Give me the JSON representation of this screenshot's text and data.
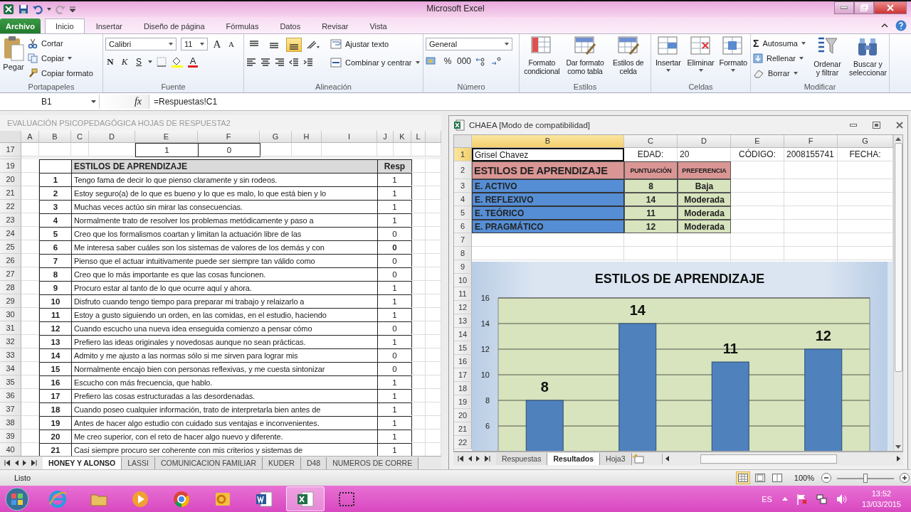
{
  "app": {
    "title": "Microsoft Excel"
  },
  "ribbon": {
    "file_tab": {
      "label": "Archivo"
    },
    "tabs": [
      {
        "label": "Inicio",
        "selected": true
      },
      {
        "label": "Insertar",
        "selected": false
      },
      {
        "label": "Diseño de página",
        "selected": false
      },
      {
        "label": "Fórmulas",
        "selected": false
      },
      {
        "label": "Datos",
        "selected": false
      },
      {
        "label": "Revisar",
        "selected": false
      },
      {
        "label": "Vista",
        "selected": false
      }
    ],
    "clipboard": {
      "label": "Portapapeles",
      "paste": "Pegar",
      "cut": "Cortar",
      "copy": "Copiar",
      "format_painter": "Copiar formato"
    },
    "font": {
      "label": "Fuente",
      "name": "Calibri",
      "size": "11",
      "grow": "A",
      "shrink": "A",
      "bold": "N",
      "italic": "K",
      "underline": "S",
      "font_color_button": "A"
    },
    "alignment": {
      "label": "Alineación",
      "wrap_text": "Ajustar texto",
      "merge_center": "Combinar y centrar",
      "vertical": [
        {
          "selected": false
        },
        {
          "selected": false
        },
        {
          "selected": true
        }
      ]
    },
    "number": {
      "label": "Número",
      "format": "General",
      "percent": "%",
      "thousands": "000"
    },
    "styles": {
      "label": "Estilos",
      "buttons": [
        "Formato\ncondicional",
        "Dar formato\ncomo tabla",
        "Estilos de\ncelda"
      ]
    },
    "cells": {
      "label": "Celdas",
      "buttons": [
        "Insertar",
        "Eliminar",
        "Formato"
      ]
    },
    "editing": {
      "label": "Modificar",
      "sigma": "Σ",
      "autosum": "Autosuma",
      "fill": "Rellenar",
      "clear": "Borrar",
      "sort": "Ordenar\ny filtrar",
      "find": "Buscar y\nseleccionar"
    }
  },
  "formula_bar": {
    "name_box": "B1",
    "fx": "fx",
    "formula": "=Respuestas!C1"
  },
  "left_window": {
    "title": "EVALUACIÓN PSICOPEDAGÓGICA HOJAS DE RESPUESTA2",
    "columns": [
      "A",
      "B",
      "C",
      "D",
      "E",
      "F",
      "G",
      "H",
      "I",
      "J",
      "K",
      "L"
    ],
    "rows": [
      {
        "number": "17",
        "kind": "values",
        "e": "1",
        "f": "0"
      },
      {
        "number": "19",
        "kind": "header",
        "title": "ESTILOS DE APRENDIZAJE",
        "resp": "Resp"
      },
      {
        "number": "20",
        "kind": "item",
        "index": "1",
        "text": "Tengo fama de decir lo que pienso claramente y sin rodeos.",
        "resp": "1",
        "bold": false
      },
      {
        "number": "21",
        "kind": "item",
        "index": "2",
        "text": "Estoy seguro(a) de lo que es bueno y lo que es malo, lo que está bien y lo",
        "resp": "1",
        "bold": false
      },
      {
        "number": "22",
        "kind": "item",
        "index": "3",
        "text": "Muchas veces actúo sin mirar las consecuencias.",
        "resp": "1",
        "bold": false
      },
      {
        "number": "23",
        "kind": "item",
        "index": "4",
        "text": "Normalmente trato de resolver los problemas metódicamente y paso a",
        "resp": "1",
        "bold": false
      },
      {
        "number": "24",
        "kind": "item",
        "index": "5",
        "text": "Creo que los formalismos coartan y limitan la actuación libre de las",
        "resp": "0",
        "bold": false
      },
      {
        "number": "25",
        "kind": "item",
        "index": "6",
        "text": "Me interesa saber cuáles son los sistemas de valores de los demás y con",
        "resp": "0",
        "bold": true
      },
      {
        "number": "26",
        "kind": "item",
        "index": "7",
        "text": "Pienso que el actuar intuitivamente puede ser siempre tan válido como",
        "resp": "0",
        "bold": false
      },
      {
        "number": "27",
        "kind": "item",
        "index": "8",
        "text": "Creo que lo más importante es que las cosas funcionen.",
        "resp": "0",
        "bold": false
      },
      {
        "number": "28",
        "kind": "item",
        "index": "9",
        "text": "Procuro estar al tanto de lo que ocurre aquí y ahora.",
        "resp": "1",
        "bold": false
      },
      {
        "number": "29",
        "kind": "item",
        "index": "10",
        "text": "Disfruto cuando tengo tiempo para preparar mi trabajo y relaizarlo a",
        "resp": "1",
        "bold": false
      },
      {
        "number": "30",
        "kind": "item",
        "index": "11",
        "text": "Estoy a gusto siguiendo un orden, en las comidas, en el estudio, haciendo",
        "resp": "1",
        "bold": false
      },
      {
        "number": "31",
        "kind": "item",
        "index": "12",
        "text": "Cuando escucho una nueva idea enseguida comienzo a pensar cómo",
        "resp": "0",
        "bold": false
      },
      {
        "number": "32",
        "kind": "item",
        "index": "13",
        "text": "Prefiero las ideas originales y novedosas aunque no sean prácticas.",
        "resp": "1",
        "bold": false
      },
      {
        "number": "33",
        "kind": "item",
        "index": "14",
        "text": "Admito y me ajusto a las normas sólo si me sirven para lograr mis",
        "resp": "0",
        "bold": false
      },
      {
        "number": "34",
        "kind": "item",
        "index": "15",
        "text": "Normalmente encajo bien con personas reflexivas, y me cuesta sintonizar",
        "resp": "0",
        "bold": false
      },
      {
        "number": "35",
        "kind": "item",
        "index": "16",
        "text": "Escucho con más frecuencia, que hablo.",
        "resp": "1",
        "bold": false
      },
      {
        "number": "36",
        "kind": "item",
        "index": "17",
        "text": "Prefiero las cosas estructuradas a las desordenadas.",
        "resp": "1",
        "bold": false
      },
      {
        "number": "37",
        "kind": "item",
        "index": "18",
        "text": "Cuando poseo cualquier información, trato de interpretarla bien antes de",
        "resp": "1",
        "bold": false
      },
      {
        "number": "38",
        "kind": "item",
        "index": "19",
        "text": "Antes de hacer algo estudio con cuidado sus ventajas e inconvenientes.",
        "resp": "1",
        "bold": false
      },
      {
        "number": "39",
        "kind": "item",
        "index": "20",
        "text": "Me creo superior, con el reto de hacer algo nuevo y diferente.",
        "resp": "1",
        "bold": false
      },
      {
        "number": "40",
        "kind": "item",
        "index": "21",
        "text": "Casi siempre procuro ser coherente con mis criterios y sistemas de",
        "resp": "1",
        "bold": false
      }
    ],
    "sheet_tabs": [
      {
        "label": "HONEY Y ALONSO",
        "selected": true
      },
      {
        "label": "LASSI",
        "selected": false
      },
      {
        "label": "COMUNICACION FAMILIAR",
        "selected": false
      },
      {
        "label": "KUDER",
        "selected": false
      },
      {
        "label": "D48",
        "selected": false
      },
      {
        "label": "NUMEROS DE CORRE",
        "selected": false
      }
    ]
  },
  "right_window": {
    "title": "CHAEA  [Modo de compatibilidad]",
    "columns": [
      {
        "label": "B",
        "selected": true
      },
      {
        "label": "C",
        "selected": false
      },
      {
        "label": "D",
        "selected": false
      },
      {
        "label": "E",
        "selected": false
      },
      {
        "label": "F",
        "selected": false
      },
      {
        "label": "G",
        "selected": false
      }
    ],
    "rows": [
      {
        "number": "1",
        "kind": "info",
        "selected": true,
        "cells": [
          "Grisel Chavez",
          "EDAD:",
          "20",
          "CÓDIGO:",
          "2008155741",
          "FECHA:"
        ]
      },
      {
        "number": "2",
        "kind": "header",
        "selected": false,
        "cells": [
          "ESTILOS DE APRENDIZAJE",
          "PUNTUACIÓN",
          "PREFERENCIA"
        ]
      },
      {
        "number": "3",
        "kind": "style",
        "selected": false,
        "cells": [
          "E. ACTIVO",
          "8",
          "Baja"
        ]
      },
      {
        "number": "4",
        "kind": "style",
        "selected": false,
        "cells": [
          "E. REFLEXIVO",
          "14",
          "Moderada"
        ]
      },
      {
        "number": "5",
        "kind": "style",
        "selected": false,
        "cells": [
          "E. TEÓRICO",
          "11",
          "Moderada"
        ]
      },
      {
        "number": "6",
        "kind": "style",
        "selected": false,
        "cells": [
          "E. PRAGMÁTICO",
          "12",
          "Moderada"
        ]
      },
      {
        "number": "7",
        "kind": "empty",
        "selected": false
      },
      {
        "number": "8",
        "kind": "empty",
        "selected": false
      },
      {
        "number": "9",
        "kind": "empty",
        "selected": false
      },
      {
        "number": "10",
        "kind": "empty",
        "selected": false
      },
      {
        "number": "11",
        "kind": "empty",
        "selected": false
      },
      {
        "number": "12",
        "kind": "empty",
        "selected": false
      },
      {
        "number": "13",
        "kind": "empty",
        "selected": false
      },
      {
        "number": "14",
        "kind": "empty",
        "selected": false
      },
      {
        "number": "15",
        "kind": "empty",
        "selected": false
      },
      {
        "number": "16",
        "kind": "empty",
        "selected": false
      },
      {
        "number": "17",
        "kind": "empty",
        "selected": false
      },
      {
        "number": "18",
        "kind": "empty",
        "selected": false
      },
      {
        "number": "19",
        "kind": "empty",
        "selected": false
      },
      {
        "number": "20",
        "kind": "empty",
        "selected": false
      },
      {
        "number": "21",
        "kind": "empty",
        "selected": false
      },
      {
        "number": "22",
        "kind": "empty",
        "selected": false
      }
    ],
    "chart": {
      "chart_data": {
        "type": "bar",
        "title": "ESTILOS DE APRENDIZAJE",
        "values": [
          8,
          14,
          11,
          12
        ],
        "ylim": [
          4,
          16
        ],
        "yticks": [
          6,
          8,
          10,
          12,
          14,
          16
        ],
        "grid": true,
        "data_labels": true
      }
    },
    "sheet_tabs": [
      {
        "label": "Respuestas",
        "selected": false
      },
      {
        "label": "Resultados",
        "selected": true
      },
      {
        "label": "Hoja3",
        "selected": false
      }
    ]
  },
  "status_bar": {
    "ready": "Listo",
    "views": [
      {
        "selected": true
      },
      {
        "selected": false
      },
      {
        "selected": false
      }
    ],
    "zoom": "100%",
    "zoom_slider": {
      "level": 0.5
    }
  },
  "taskbar": {
    "apps": [
      {
        "kind": "ie",
        "selected": false
      },
      {
        "kind": "folder",
        "selected": false
      },
      {
        "kind": "media",
        "selected": false
      },
      {
        "kind": "chrome",
        "selected": false
      },
      {
        "kind": "outlook",
        "selected": false
      },
      {
        "kind": "word",
        "selected": false
      },
      {
        "kind": "excel",
        "selected": true
      },
      {
        "kind": "snip",
        "selected": false
      }
    ],
    "language": "ES",
    "time": "13:52",
    "date": "13/03/2015"
  }
}
